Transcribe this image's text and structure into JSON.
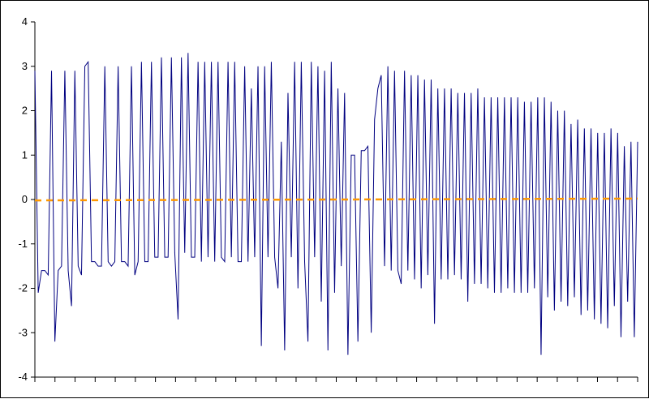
{
  "chart_data": {
    "type": "line",
    "title": "",
    "xlabel": "",
    "ylabel": "",
    "ylim": [
      -4,
      4
    ],
    "yticks": [
      4,
      3,
      2,
      1,
      0,
      -1,
      -2,
      -3,
      -4
    ],
    "x_tick_count": 30,
    "grid": false,
    "legend": "none",
    "series": [
      {
        "name": "",
        "color": "#000080",
        "style": "solid",
        "values": [
          2.9,
          -2.1,
          -1.6,
          -1.6,
          -1.7,
          2.9,
          -3.2,
          -1.6,
          -1.5,
          2.9,
          -1.6,
          -2.4,
          2.9,
          -1.5,
          -1.7,
          3.0,
          3.1,
          -1.4,
          -1.4,
          -1.5,
          -1.5,
          3.0,
          -1.4,
          -1.5,
          -1.4,
          3.0,
          -1.4,
          -1.4,
          -1.5,
          3.0,
          -1.7,
          -1.4,
          3.1,
          -1.4,
          -1.4,
          3.1,
          -1.3,
          -1.3,
          3.2,
          -1.3,
          -1.3,
          3.2,
          -1.2,
          -2.7,
          3.2,
          -1.2,
          3.3,
          -1.3,
          -1.3,
          3.1,
          -1.4,
          3.1,
          -1.3,
          3.1,
          -1.4,
          3.1,
          -1.3,
          -1.4,
          3.1,
          -1.3,
          3.1,
          -1.4,
          -1.4,
          3.0,
          -1.4,
          2.5,
          -1.3,
          3.0,
          -3.3,
          3.0,
          -1.3,
          3.1,
          -1.3,
          -2.0,
          1.3,
          -3.4,
          2.4,
          -1.3,
          3.1,
          -2.0,
          3.1,
          -1.4,
          -3.2,
          3.1,
          -1.3,
          3.0,
          -2.3,
          2.9,
          -3.4,
          3.1,
          -2.1,
          2.5,
          -1.5,
          2.4,
          -3.5,
          1.0,
          1.0,
          -3.2,
          1.1,
          1.1,
          1.2,
          -3.0,
          1.8,
          2.5,
          2.8,
          -1.5,
          3.0,
          -1.6,
          2.9,
          -1.6,
          -1.9,
          2.9,
          -1.6,
          2.8,
          -1.8,
          2.8,
          -2.0,
          2.7,
          -1.7,
          2.7,
          -2.8,
          2.5,
          -1.8,
          2.5,
          -1.8,
          2.5,
          -1.7,
          2.4,
          -1.8,
          2.4,
          -2.3,
          2.4,
          -1.9,
          2.5,
          -1.9,
          2.3,
          -2.0,
          2.3,
          -2.1,
          2.3,
          -2.1,
          2.3,
          -2.0,
          2.3,
          -2.1,
          2.3,
          -2.1,
          2.2,
          -2.1,
          2.2,
          -2.0,
          2.3,
          -3.5,
          2.3,
          -2.2,
          2.2,
          -2.5,
          2.0,
          -2.3,
          2.0,
          -2.4,
          1.7,
          -2.2,
          1.8,
          -2.6,
          1.6,
          -2.5,
          1.6,
          -2.7,
          1.5,
          -2.8,
          1.5,
          -2.9,
          1.6,
          -2.4,
          1.5,
          -3.1,
          1.2,
          -2.3,
          1.3,
          -3.1,
          1.3
        ]
      },
      {
        "name": "",
        "color": "#ff9900",
        "style": "dashed",
        "values": [
          -0.02,
          0.0,
          0.02
        ]
      }
    ]
  }
}
